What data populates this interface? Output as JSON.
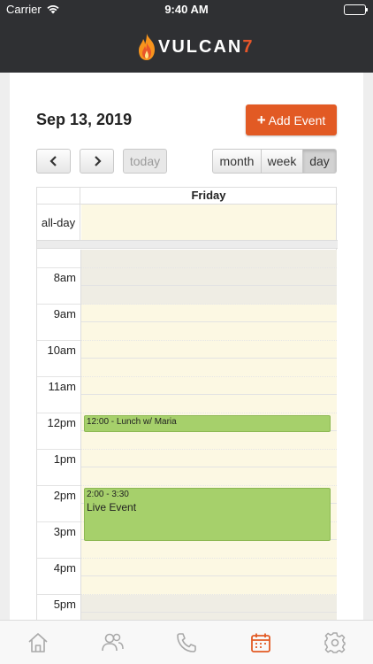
{
  "status_bar": {
    "carrier": "Carrier",
    "time": "9:40 AM"
  },
  "header": {
    "brand_word": "VULCAN",
    "brand_suffix": "7"
  },
  "calendar": {
    "date_title": "Sep 13, 2019",
    "add_event_label": "Add Event",
    "add_event_plus": "+",
    "prev_icon": "chevron-left-icon",
    "next_icon": "chevron-right-icon",
    "today_label": "today",
    "views": {
      "month": "month",
      "week": "week",
      "day": "day",
      "selected": "day"
    },
    "day_header": "Friday",
    "allday_label": "all-day",
    "hours": [
      "8am",
      "9am",
      "10am",
      "11am",
      "12pm",
      "1pm",
      "2pm",
      "3pm",
      "4pm",
      "5pm"
    ],
    "events": [
      {
        "time": "12:00 - Lunch w/ Maria",
        "title": ""
      },
      {
        "time": "2:00 - 3:30",
        "title": "Live Event"
      }
    ],
    "colors": {
      "event_bg": "#a6d06b",
      "business_hours_bg": "#fcf8e3",
      "accent": "#e25a24"
    }
  },
  "tabs": [
    {
      "icon": "home-icon",
      "active": false
    },
    {
      "icon": "users-icon",
      "active": false
    },
    {
      "icon": "phone-icon",
      "active": false
    },
    {
      "icon": "calendar-icon",
      "active": true
    },
    {
      "icon": "gear-icon",
      "active": false
    }
  ]
}
